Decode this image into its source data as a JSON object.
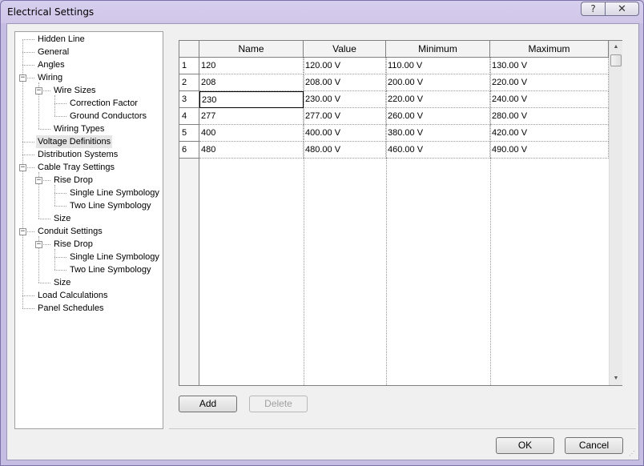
{
  "window": {
    "title": "Electrical Settings",
    "help_glyph": "?",
    "close_glyph": "✕"
  },
  "tree": {
    "items": [
      {
        "label": "Hidden Line",
        "level": 0
      },
      {
        "label": "General",
        "level": 0
      },
      {
        "label": "Angles",
        "level": 0
      },
      {
        "label": "Wiring",
        "level": 0,
        "expanded": true
      },
      {
        "label": "Wire Sizes",
        "level": 1,
        "expanded": true
      },
      {
        "label": "Correction Factor",
        "level": 2
      },
      {
        "label": "Ground Conductors",
        "level": 2
      },
      {
        "label": "Wiring Types",
        "level": 1
      },
      {
        "label": "Voltage Definitions",
        "level": 0,
        "selected": true
      },
      {
        "label": "Distribution Systems",
        "level": 0
      },
      {
        "label": "Cable Tray Settings",
        "level": 0,
        "expanded": true
      },
      {
        "label": "Rise Drop",
        "level": 1,
        "expanded": true
      },
      {
        "label": "Single Line Symbology",
        "level": 2
      },
      {
        "label": "Two Line Symbology",
        "level": 2
      },
      {
        "label": "Size",
        "level": 1
      },
      {
        "label": "Conduit Settings",
        "level": 0,
        "expanded": true
      },
      {
        "label": "Rise Drop",
        "level": 1,
        "expanded": true
      },
      {
        "label": "Single Line Symbology",
        "level": 2
      },
      {
        "label": "Two Line Symbology",
        "level": 2
      },
      {
        "label": "Size",
        "level": 1
      },
      {
        "label": "Load Calculations",
        "level": 0
      },
      {
        "label": "Panel Schedules",
        "level": 0
      }
    ]
  },
  "grid": {
    "columns": [
      "Name",
      "Value",
      "Minimum",
      "Maximum"
    ],
    "rows": [
      {
        "num": "1",
        "cells": [
          "120",
          "120.00 V",
          "110.00 V",
          "130.00 V"
        ]
      },
      {
        "num": "2",
        "cells": [
          "208",
          "208.00 V",
          "200.00 V",
          "220.00 V"
        ]
      },
      {
        "num": "3",
        "cells": [
          "230",
          "230.00 V",
          "220.00 V",
          "240.00 V"
        ],
        "selected_col": 0
      },
      {
        "num": "4",
        "cells": [
          "277",
          "277.00 V",
          "260.00 V",
          "280.00 V"
        ]
      },
      {
        "num": "5",
        "cells": [
          "400",
          "400.00 V",
          "380.00 V",
          "420.00 V"
        ]
      },
      {
        "num": "6",
        "cells": [
          "480",
          "480.00 V",
          "460.00 V",
          "490.00 V"
        ]
      }
    ]
  },
  "buttons": {
    "add": "Add",
    "delete": "Delete",
    "ok": "OK",
    "cancel": "Cancel"
  },
  "icons": {
    "expander_minus": "−",
    "scroll_up": "▲",
    "scroll_down": "▼",
    "grip": "⋰"
  }
}
